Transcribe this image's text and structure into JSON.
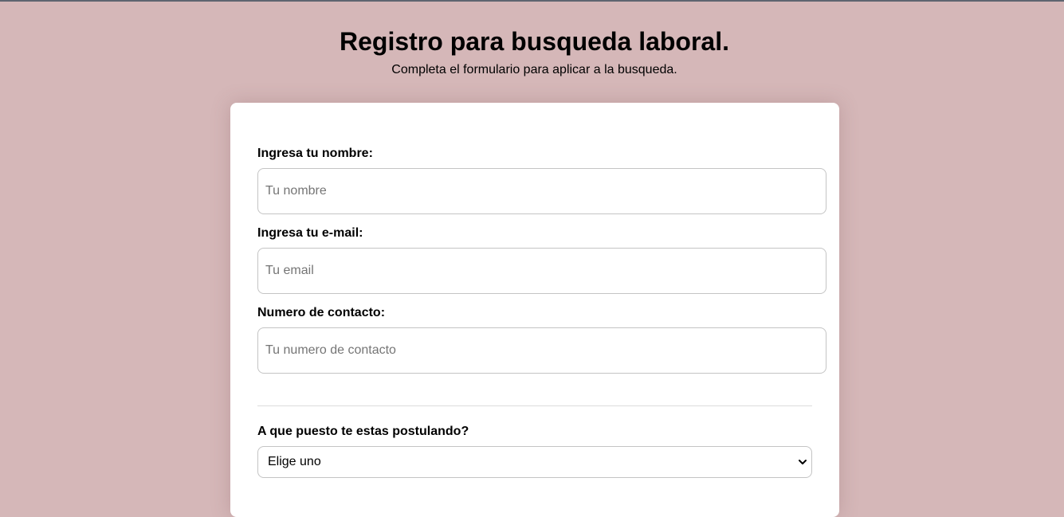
{
  "header": {
    "title": "Registro para busqueda laboral.",
    "subtitle": "Completa el formulario para aplicar a la busqueda."
  },
  "form": {
    "name": {
      "label": "Ingresa tu nombre:",
      "placeholder": "Tu nombre",
      "value": ""
    },
    "email": {
      "label": "Ingresa tu e-mail:",
      "placeholder": "Tu email",
      "value": ""
    },
    "phone": {
      "label": "Numero de contacto:",
      "placeholder": "Tu numero de contacto",
      "value": ""
    },
    "position": {
      "label": "A que puesto te estas postulando?",
      "selected": "Elige uno",
      "icon": "chevron-down-icon"
    }
  },
  "colors": {
    "background": "#d5b7b8",
    "card": "#ffffff",
    "input_border": "#c4c4c4",
    "top_border": "#5e6470"
  }
}
